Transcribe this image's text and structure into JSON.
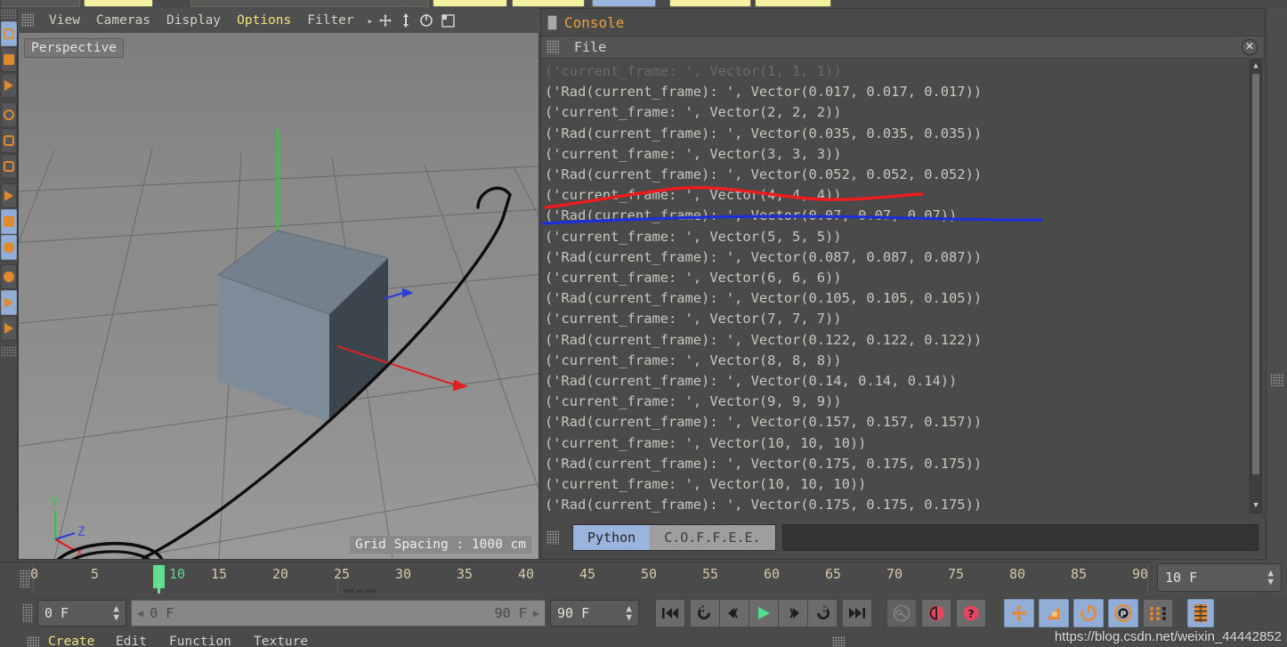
{
  "app": {
    "name": "Cinema 4D"
  },
  "viewport": {
    "menu_grip": "menu-grip",
    "items": [
      {
        "label": "View",
        "active": false
      },
      {
        "label": "Cameras",
        "active": false
      },
      {
        "label": "Display",
        "active": false
      },
      {
        "label": "Options",
        "active": true
      },
      {
        "label": "Filter",
        "active": false
      }
    ],
    "overflow_arrow": "▸",
    "icons": [
      "move-icon",
      "axis-icon",
      "rotate-icon",
      "layout-icon"
    ],
    "view_label": "Perspective",
    "grid_spacing": "Grid Spacing : 1000 cm",
    "axis_gizmo": {
      "y": "Y",
      "z": "Z",
      "x": "X",
      "y_color": "#3ecb52",
      "z_color": "#3b4fe0",
      "x_color": "#e03b3b"
    },
    "object": "cube",
    "annotation_colors": {
      "ink": "#0d0d0d",
      "red": "#ee1c1c",
      "blue": "#1d2fd8"
    }
  },
  "console": {
    "title": "Console",
    "file_menu": "File",
    "close_icon": "close-icon",
    "lines": [
      "('Rad(current_frame): ', Vector(0.017, 0.017, 0.017))",
      "('current_frame: ', Vector(2, 2, 2))",
      "('Rad(current_frame): ', Vector(0.035, 0.035, 0.035))",
      "('current_frame: ', Vector(3, 3, 3))",
      "('Rad(current_frame): ', Vector(0.052, 0.052, 0.052))",
      "('current_frame: ', Vector(4, 4, 4))",
      "('Rad(current_frame): ', Vector(0.07, 0.07, 0.07))",
      "('current_frame: ', Vector(5, 5, 5))",
      "('Rad(current_frame): ', Vector(0.087, 0.087, 0.087))",
      "('current_frame: ', Vector(6, 6, 6))",
      "('Rad(current_frame): ', Vector(0.105, 0.105, 0.105))",
      "('current_frame: ', Vector(7, 7, 7))",
      "('Rad(current_frame): ', Vector(0.122, 0.122, 0.122))",
      "('current_frame: ', Vector(8, 8, 8))",
      "('Rad(current_frame): ', Vector(0.14, 0.14, 0.14))",
      "('current_frame: ', Vector(9, 9, 9))",
      "('Rad(current_frame): ', Vector(0.157, 0.157, 0.157))",
      "('current_frame: ', Vector(10, 10, 10))",
      "('Rad(current_frame): ', Vector(0.175, 0.175, 0.175))",
      "('current_frame: ', Vector(10, 10, 10))",
      "('Rad(current_frame): ', Vector(0.175, 0.175, 0.175))"
    ],
    "tabs": [
      {
        "label": "Python",
        "selected": true
      },
      {
        "label": "C.O.F.F.E.E.",
        "selected": false
      }
    ],
    "input_value": "",
    "input_placeholder": ""
  },
  "timeline": {
    "ticks": [
      "0",
      "5",
      "10",
      "15",
      "20",
      "25",
      "30",
      "35",
      "40",
      "45",
      "50",
      "55",
      "60",
      "65",
      "70",
      "75",
      "80",
      "85",
      "90"
    ],
    "current_frame_tick": "10",
    "marker_frame": 10,
    "frame_field": "10 F"
  },
  "bottom_bar": {
    "start_frame": "0 F",
    "range_start": "0 F",
    "range_end": "90 F",
    "end_frame": "90 F",
    "transport": [
      {
        "name": "go-to-start-icon",
        "glyph": "⏮"
      },
      {
        "name": "play-backward-icon",
        "glyph": "↶"
      },
      {
        "name": "step-back-icon",
        "glyph": "◂"
      },
      {
        "name": "play-icon",
        "glyph": "▶"
      },
      {
        "name": "step-forward-icon",
        "glyph": "▸"
      },
      {
        "name": "play-forward-icon",
        "glyph": "↷"
      },
      {
        "name": "go-to-end-icon",
        "glyph": "⏭"
      }
    ],
    "key_tools": [
      {
        "name": "autokey-icon",
        "selected": false
      },
      {
        "name": "record-icon",
        "selected": false
      },
      {
        "name": "record-active-icon",
        "selected": false
      }
    ],
    "right_tools": [
      {
        "name": "position-key-icon",
        "selected": true
      },
      {
        "name": "scale-key-icon",
        "selected": true
      },
      {
        "name": "rotation-key-icon",
        "selected": true
      },
      {
        "name": "parameter-key-icon",
        "selected": true
      },
      {
        "name": "point-level-anim-icon",
        "selected": false
      },
      {
        "name": "timeline-icon",
        "selected": true
      }
    ]
  },
  "bottom_menu": {
    "items": [
      {
        "label": "Create",
        "active": true
      },
      {
        "label": "Edit",
        "active": false
      },
      {
        "label": "Function",
        "active": false
      },
      {
        "label": "Texture",
        "active": false
      }
    ]
  },
  "watermark": "https://blog.csdn.net/weixin_44442852"
}
